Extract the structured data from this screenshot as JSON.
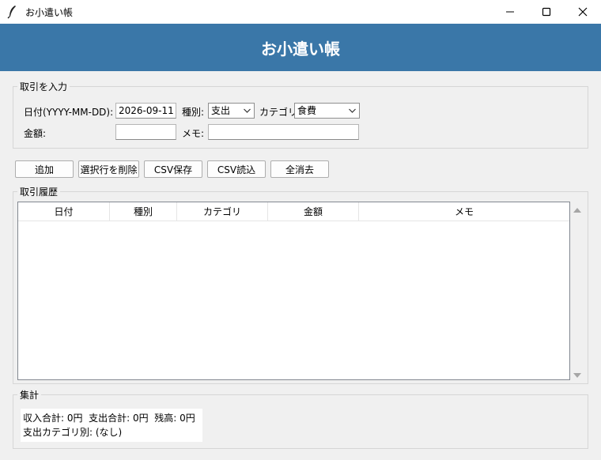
{
  "window": {
    "title": "お小遣い帳",
    "icon": "feather-icon"
  },
  "header": {
    "title": "お小遣い帳"
  },
  "form": {
    "group_label": "取引を入力",
    "date_label": "日付(YYYY-MM-DD):",
    "date_value": "2026-09-11",
    "type_label": "種別:",
    "type_value": "支出",
    "category_label": "カテゴリ:",
    "category_value": "食費",
    "amount_label": "金額:",
    "amount_value": "",
    "memo_label": "メモ:",
    "memo_value": ""
  },
  "toolbar": {
    "add": "追加",
    "delete_selected": "選択行を削除",
    "csv_save": "CSV保存",
    "csv_load": "CSV読込",
    "clear_all": "全消去"
  },
  "history": {
    "group_label": "取引履歴",
    "columns": [
      "日付",
      "種別",
      "カテゴリ",
      "金額",
      "メモ"
    ],
    "rows": []
  },
  "summary": {
    "group_label": "集計",
    "line1": "収入合計: 0円  支出合計: 0円  残高: 0円",
    "line2": "支出カテゴリ別: (なし)"
  }
}
